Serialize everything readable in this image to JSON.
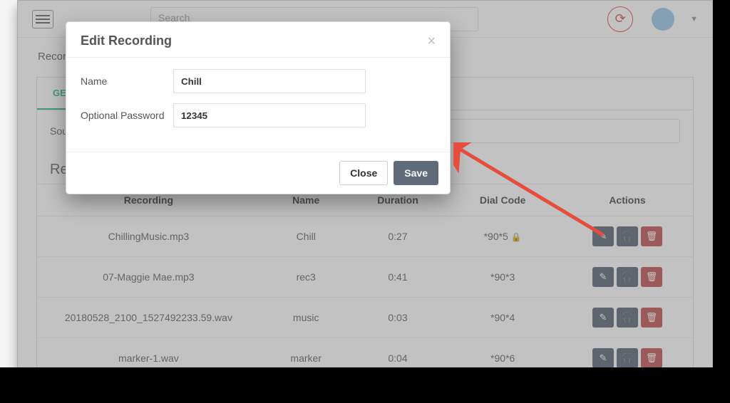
{
  "topbar": {
    "search_placeholder": "Search"
  },
  "breadcrumb": "Recording",
  "tabs": {
    "general": "GENERAL"
  },
  "panel": {
    "sound_label": "Sound",
    "recordings_heading": "Recordings"
  },
  "table": {
    "headers": {
      "recording": "Recording",
      "name": "Name",
      "duration": "Duration",
      "dial_code": "Dial Code",
      "actions": "Actions"
    },
    "rows": [
      {
        "recording": "ChillingMusic.mp3",
        "name": "Chill",
        "duration": "0:27",
        "dial_code": "*90*5",
        "locked": true
      },
      {
        "recording": "07-Maggie Mae.mp3",
        "name": "rec3",
        "duration": "0:41",
        "dial_code": "*90*3",
        "locked": false
      },
      {
        "recording": "20180528_2100_1527492233.59.wav",
        "name": "music",
        "duration": "0:03",
        "dial_code": "*90*4",
        "locked": false
      },
      {
        "recording": "marker-1.wav",
        "name": "marker",
        "duration": "0:04",
        "dial_code": "*90*6",
        "locked": false
      }
    ]
  },
  "modal": {
    "title": "Edit Recording",
    "name_label": "Name",
    "name_value": "Chill",
    "password_label": "Optional Password",
    "password_value": "12345",
    "close_label": "Close",
    "save_label": "Save"
  }
}
